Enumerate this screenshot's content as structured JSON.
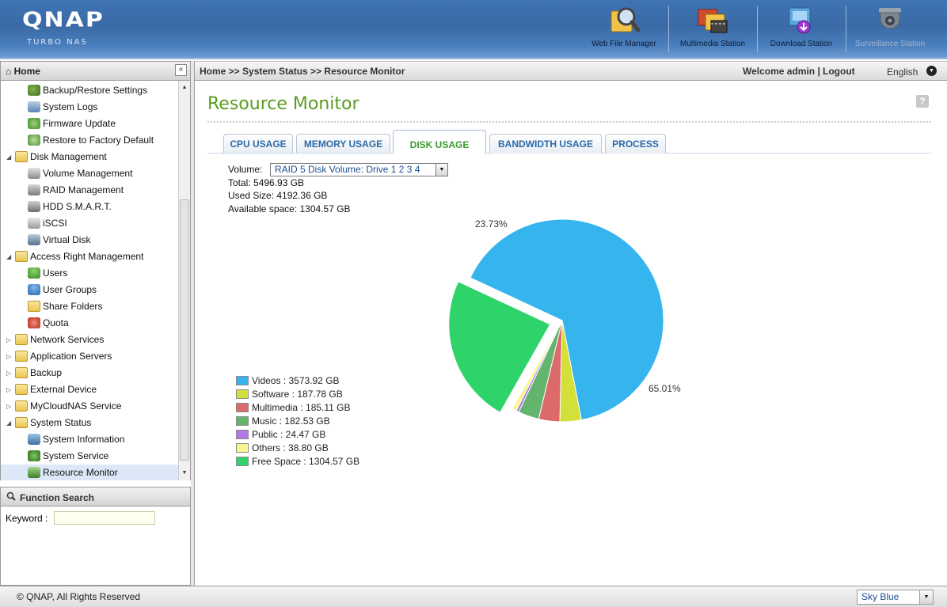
{
  "header": {
    "logo": "QNAP",
    "logo_sub": "TURBO NAS",
    "apps": [
      {
        "label": "Web File Manager",
        "icon": "web-file-manager-icon"
      },
      {
        "label": "Multimedia Station",
        "icon": "multimedia-station-icon"
      },
      {
        "label": "Download Station",
        "icon": "download-station-icon"
      },
      {
        "label": "Surveillance Station",
        "icon": "surveillance-station-icon"
      }
    ]
  },
  "nav": {
    "title": "Home",
    "collapse_label": "«",
    "items": [
      {
        "label": "Backup/Restore Settings",
        "icon": "backup-restore-icon"
      },
      {
        "label": "System Logs",
        "icon": "system-logs-icon"
      },
      {
        "label": "Firmware Update",
        "icon": "firmware-update-icon"
      },
      {
        "label": "Restore to Factory Default",
        "icon": "factory-default-icon"
      },
      {
        "label": "Disk Management",
        "icon": "folder-icon",
        "expanded": true
      },
      {
        "label": "Volume Management",
        "icon": "volume-management-icon"
      },
      {
        "label": "RAID Management",
        "icon": "raid-management-icon"
      },
      {
        "label": "HDD S.M.A.R.T.",
        "icon": "hdd-smart-icon"
      },
      {
        "label": "iSCSI",
        "icon": "iscsi-icon"
      },
      {
        "label": "Virtual Disk",
        "icon": "virtual-disk-icon"
      },
      {
        "label": "Access Right Management",
        "icon": "folder-icon",
        "expanded": true
      },
      {
        "label": "Users",
        "icon": "users-icon"
      },
      {
        "label": "User Groups",
        "icon": "user-groups-icon"
      },
      {
        "label": "Share Folders",
        "icon": "share-folders-icon"
      },
      {
        "label": "Quota",
        "icon": "quota-icon"
      },
      {
        "label": "Network Services",
        "icon": "folder-icon",
        "expanded": false
      },
      {
        "label": "Application Servers",
        "icon": "folder-icon",
        "expanded": false
      },
      {
        "label": "Backup",
        "icon": "folder-icon",
        "expanded": false
      },
      {
        "label": "External Device",
        "icon": "folder-icon",
        "expanded": false
      },
      {
        "label": "MyCloudNAS Service",
        "icon": "folder-icon",
        "expanded": false
      },
      {
        "label": "System Status",
        "icon": "folder-icon",
        "expanded": true
      },
      {
        "label": "System Information",
        "icon": "system-information-icon"
      },
      {
        "label": "System Service",
        "icon": "system-service-icon"
      },
      {
        "label": "Resource Monitor",
        "icon": "resource-monitor-icon",
        "selected": true
      }
    ]
  },
  "function_search": {
    "title": "Function Search",
    "keyword_label": "Keyword :",
    "keyword_value": ""
  },
  "topbar": {
    "breadcrumb": "Home >> System Status >> Resource Monitor",
    "welcome": "Welcome admin",
    "separator": "|",
    "logout": "Logout",
    "language": "English"
  },
  "page": {
    "title": "Resource Monitor",
    "help": "?",
    "tabs": [
      "CPU USAGE",
      "MEMORY USAGE",
      "DISK USAGE",
      "BANDWIDTH USAGE",
      "PROCESS"
    ],
    "active_tab": "DISK USAGE",
    "volume_label": "Volume:",
    "volume_value": "RAID 5 Disk Volume: Drive 1 2 3 4",
    "total": "Total: 5496.93 GB",
    "used": "Used Size: 4192.36 GB",
    "available": "Available space: 1304.57 GB"
  },
  "chart_data": {
    "type": "pie",
    "unit": "GB",
    "slices": [
      {
        "name": "Videos",
        "label": "Videos : 3573.92 GB",
        "value": 3573.92,
        "color": "#36b4ee"
      },
      {
        "name": "Software",
        "label": "Software : 187.78 GB",
        "value": 187.78,
        "color": "#d2e039"
      },
      {
        "name": "Multimedia",
        "label": "Multimedia : 185.11 GB",
        "value": 185.11,
        "color": "#dc6a6a"
      },
      {
        "name": "Music",
        "label": "Music : 182.53 GB",
        "value": 182.53,
        "color": "#63b46c"
      },
      {
        "name": "Public",
        "label": "Public : 24.47 GB",
        "value": 24.47,
        "color": "#b377e6"
      },
      {
        "name": "Others",
        "label": "Others : 38.80 GB",
        "value": 38.8,
        "color": "#f7f78c"
      },
      {
        "name": "Free Space",
        "label": "Free Space : 1304.57 GB",
        "value": 1304.57,
        "color": "#2ed36a"
      }
    ],
    "percent_labels": [
      {
        "slice": "Videos",
        "text": "65.01%"
      },
      {
        "slice": "Free Space",
        "text": "23.73%"
      }
    ],
    "exploded": [
      "Free Space"
    ],
    "legend_position": "bottom-left"
  },
  "footer": {
    "copyright": "© QNAP, All Rights Reserved",
    "theme": "Sky Blue"
  }
}
